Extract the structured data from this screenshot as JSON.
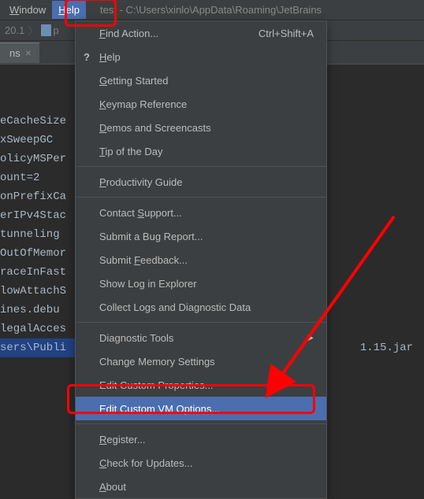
{
  "menubar": {
    "window_label": "Window",
    "help_label": "Help"
  },
  "title": "test - C:\\Users\\xinlo\\AppData\\Roaming\\JetBrains",
  "breadcrumb": {
    "part1": "20.1",
    "part2": "p"
  },
  "tab": {
    "label": "ns"
  },
  "editor_lines": [
    "",
    "eCacheSize",
    "xSweepGC",
    "olicyMSPer",
    "",
    "ount=2",
    "onPrefixCa",
    "erIPv4Stac",
    "tunneling",
    "OutOfMemor",
    "raceInFast",
    "lowAttachS",
    "ines.debu",
    "legalAcces",
    "",
    "sers\\Publi"
  ],
  "editor_line_tail": "1.15.jar",
  "help_menu": {
    "find_action": "Find Action...",
    "find_action_shortcut": "Ctrl+Shift+A",
    "help": "Help",
    "getting_started": "Getting Started",
    "keymap_ref": "Keymap Reference",
    "demos": "Demos and Screencasts",
    "tip_of_day": "Tip of the Day",
    "productivity": "Productivity Guide",
    "contact_support": "Contact Support...",
    "submit_bug": "Submit a Bug Report...",
    "submit_feedback": "Submit Feedback...",
    "show_log": "Show Log in Explorer",
    "collect_logs": "Collect Logs and Diagnostic Data",
    "diagnostic_tools": "Diagnostic Tools",
    "change_memory": "Change Memory Settings",
    "edit_props": "Edit Custom Properties...",
    "edit_vm": "Edit Custom VM Options...",
    "register": "Register...",
    "check_updates": "Check for Updates...",
    "about": "About"
  }
}
